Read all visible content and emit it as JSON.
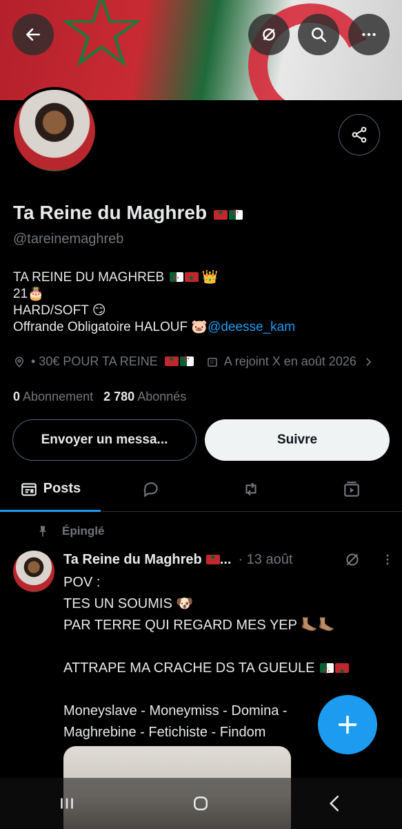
{
  "header": {
    "back_icon": "arrow-left-icon",
    "grok_icon": "grok-icon",
    "search_icon": "search-icon",
    "more_icon": "more-horizontal-icon"
  },
  "profile": {
    "name": "Ta Reine du Maghreb",
    "handle": "@tareinemaghreb",
    "bio_line1": "TA REINE DU MAGHREB",
    "bio_line2": "21",
    "bio_line3": "HARD/SOFT",
    "bio_line4": "Offrande Obligatoire HALOUF",
    "bio_link": "@deesse_kam",
    "location": "• 30€ POUR TA REINE",
    "joined": "A rejoint X en août 2026",
    "following_count": "0",
    "following_label": "Abonnement",
    "followers_count": "2 780",
    "followers_label": "Abonnés"
  },
  "buttons": {
    "message": "Envoyer un messa...",
    "follow": "Suivre"
  },
  "tabs": [
    {
      "label": "Posts",
      "icon": "posts-icon",
      "active": true
    },
    {
      "label": "",
      "icon": "reply-icon"
    },
    {
      "label": "",
      "icon": "repost-icon"
    },
    {
      "label": "",
      "icon": "media-icon"
    }
  ],
  "post": {
    "pinned_label": "Épinglé",
    "author": "Ta Reine du Maghreb",
    "ellipsis": "...",
    "time": "· 13 août",
    "line1": "POV :",
    "line2": "TES UN SOUMIS",
    "line3": "PAR TERRE QUI REGARD MES YEP",
    "line4": "ATTRAPE MA CRACHE DS TA GUEULE",
    "line5": "Moneyslave - Moneymiss - Domina -",
    "line6": "Maghrebine - Fetichiste - Findom"
  },
  "emoji": {
    "cake": "🎂",
    "smirk": "😏",
    "pig": "🐷",
    "crown": "👑",
    "dog": "🐶",
    "feet": "🦶🏽🦶🏽"
  },
  "colors": {
    "accent": "#1d9bf0",
    "muted": "#71767b",
    "text": "#e7e9ea"
  }
}
